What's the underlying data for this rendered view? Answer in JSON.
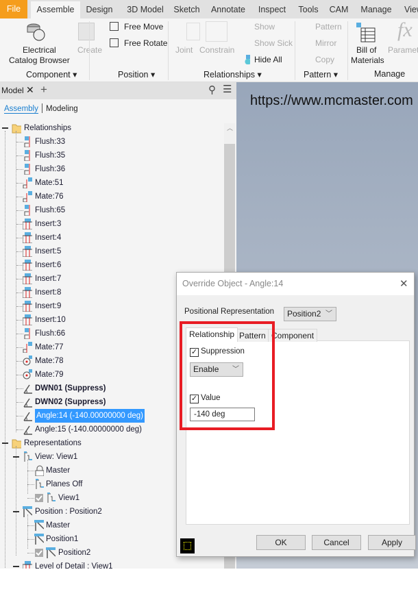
{
  "tabs": [
    "File",
    "Assemble",
    "Design",
    "3D Model",
    "Sketch",
    "Annotate",
    "Inspect",
    "Tools",
    "CAM",
    "Manage",
    "View"
  ],
  "ribbon": {
    "electrical": "Electrical",
    "catalog_browser": "Catalog Browser",
    "create": "Create",
    "component_group": "Component",
    "free_move": "Free Move",
    "free_rotate": "Free Rotate",
    "position_group": "Position",
    "joint": "Joint",
    "constrain": "Constrain",
    "show": "Show",
    "show_sick": "Show Sick",
    "hide_all": "Hide All",
    "relationships_group": "Relationships",
    "pattern": "Pattern",
    "mirror": "Mirror",
    "copy": "Copy",
    "pattern_group": "Pattern",
    "bill_of": "Bill of",
    "materials": "Materials",
    "parameters": "Paramet",
    "manage_group": "Manage"
  },
  "panel": {
    "tab": "Model",
    "assembly": "Assembly",
    "modeling": "Modeling"
  },
  "viewport": {
    "text": "https://www.mcmaster.com"
  },
  "tree": {
    "relationships": "Relationships",
    "items": [
      "Flush:33",
      "Flush:35",
      "Flush:36",
      "Mate:51",
      "Mate:76",
      "Flush:65",
      "Insert:3",
      "Insert:4",
      "Insert:5",
      "Insert:6",
      "Insert:7",
      "Insert:8",
      "Insert:9",
      "Insert:10",
      "Flush:66",
      "Mate:77",
      "Mate:78",
      "Mate:79",
      "DWN01 (Suppress)",
      "DWN02 (Suppress)",
      "Angle:14 (-140.00000000 deg)",
      "Angle:15 (-140.00000000 deg)"
    ],
    "representations": "Representations",
    "view": "View: View1",
    "master": "Master",
    "planes_off": "Planes Off",
    "view1": "View1",
    "position": "Position : Position2",
    "pos_master": "Master",
    "position1": "Position1",
    "position2": "Position2",
    "lod": "Level of Detail : View1"
  },
  "dialog": {
    "title": "Override Object - Angle:14",
    "pos_rep_label": "Positional Representation",
    "pos_rep_value": "Position2",
    "tab_relationship": "Relationship",
    "tab_pattern": "Pattern",
    "tab_component": "Component",
    "suppression": "Suppression",
    "suppression_value": "Enable",
    "value": "Value",
    "value_input": "-140 deg",
    "ok": "OK",
    "cancel": "Cancel",
    "apply": "Apply"
  },
  "colors": {
    "file_tab": "#f59d1c",
    "highlight": "#e81c24",
    "selection": "#3399ff"
  }
}
